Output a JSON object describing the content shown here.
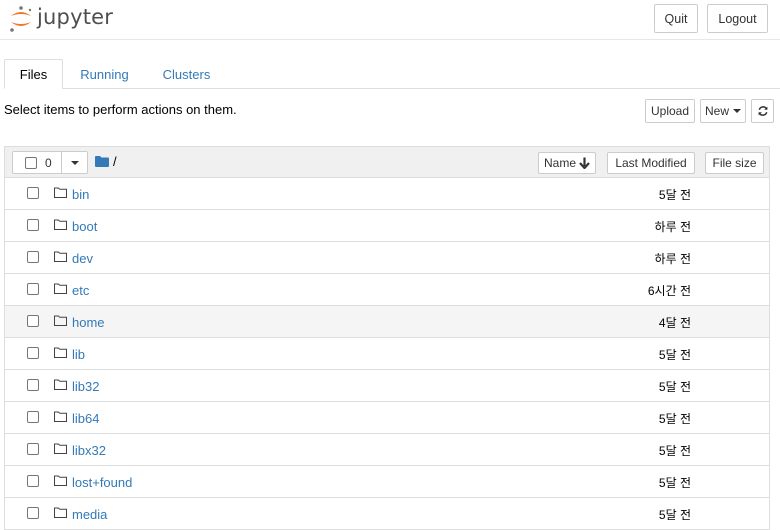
{
  "header": {
    "logo_text": "jupyter",
    "quit_label": "Quit",
    "logout_label": "Logout"
  },
  "tabs": [
    {
      "label": "Files",
      "active": true
    },
    {
      "label": "Running",
      "active": false
    },
    {
      "label": "Clusters",
      "active": false
    }
  ],
  "toolbar": {
    "hint": "Select items to perform actions on them.",
    "upload_label": "Upload",
    "new_label": "New",
    "refresh_icon": "refresh-icon"
  },
  "list_header": {
    "selected_count": "0",
    "path": "/",
    "sort_name_label": "Name",
    "sort_modified_label": "Last Modified",
    "sort_size_label": "File size"
  },
  "colors": {
    "link": "#337ab7",
    "logo_orange": "#f37726"
  },
  "items": [
    {
      "name": "bin",
      "modified": "5달 전"
    },
    {
      "name": "boot",
      "modified": "하루 전"
    },
    {
      "name": "dev",
      "modified": "하루 전"
    },
    {
      "name": "etc",
      "modified": "6시간 전"
    },
    {
      "name": "home",
      "modified": "4달 전"
    },
    {
      "name": "lib",
      "modified": "5달 전"
    },
    {
      "name": "lib32",
      "modified": "5달 전"
    },
    {
      "name": "lib64",
      "modified": "5달 전"
    },
    {
      "name": "libx32",
      "modified": "5달 전"
    },
    {
      "name": "lost+found",
      "modified": "5달 전"
    },
    {
      "name": "media",
      "modified": "5달 전"
    }
  ]
}
